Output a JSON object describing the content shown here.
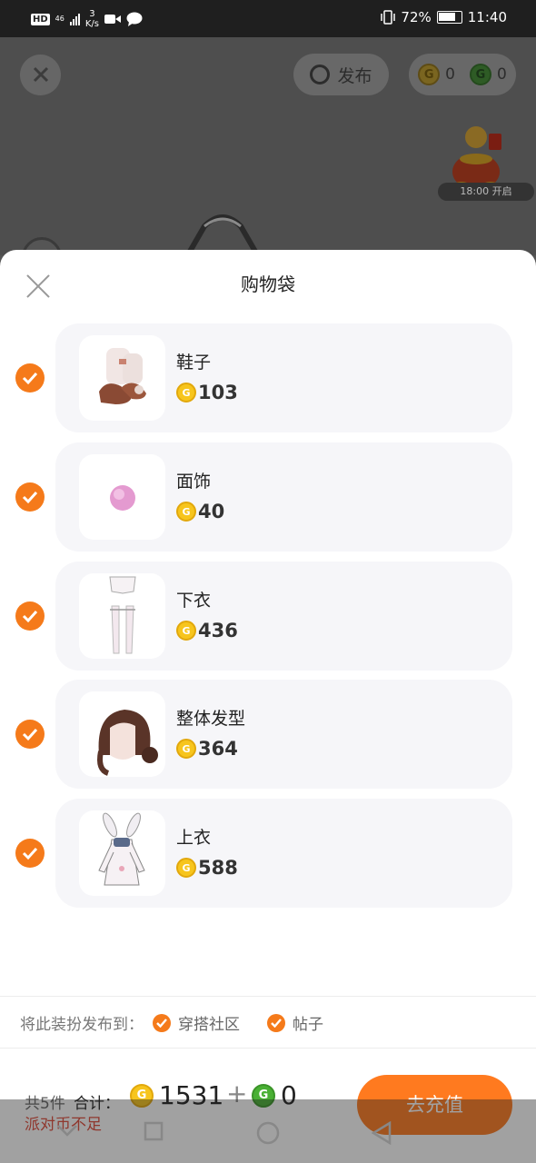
{
  "status_bar": {
    "hd": "HD",
    "network": "46",
    "speed_value": "3",
    "speed_unit": "K/s",
    "battery": "72%",
    "time": "11:40"
  },
  "top_bar": {
    "publish_label": "发布",
    "gold_count": "0",
    "green_count": "0",
    "event_time": "18:00 开启"
  },
  "sheet": {
    "title": "购物袋",
    "items": [
      {
        "name": "鞋子",
        "price": "103",
        "checked": true,
        "icon": "shoes-icon"
      },
      {
        "name": "面饰",
        "price": "40",
        "checked": true,
        "icon": "face-accessory-icon"
      },
      {
        "name": "下衣",
        "price": "436",
        "checked": true,
        "icon": "bottom-clothing-icon"
      },
      {
        "name": "整体发型",
        "price": "364",
        "checked": true,
        "icon": "hairstyle-icon"
      },
      {
        "name": "上衣",
        "price": "588",
        "checked": true,
        "icon": "top-clothing-icon"
      }
    ],
    "publish_to_label": "将此装扮发布到：",
    "publish_options": [
      "穿搭社区",
      "帖子"
    ],
    "item_count": "共5件",
    "total_label": "合计：",
    "total_gold": "1531",
    "plus": "+",
    "total_green": "0",
    "recharge_label": "去充值",
    "warning": "派对币不足"
  },
  "colors": {
    "accent": "#f57a1a",
    "gold": "#f7c51d",
    "green": "#49b034",
    "warning": "#e04a3a"
  }
}
